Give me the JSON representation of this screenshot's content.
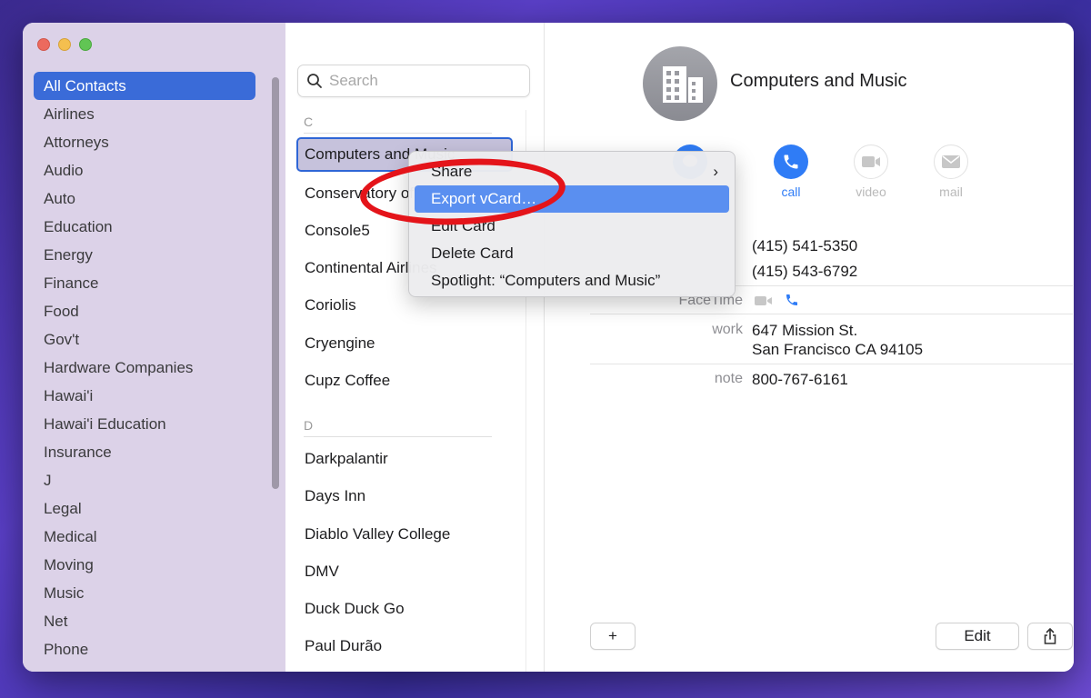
{
  "window": {
    "traffic_lights": [
      "close",
      "minimize",
      "zoom"
    ]
  },
  "sidebar": {
    "groups": [
      {
        "label": "All Contacts",
        "active": true
      },
      {
        "label": "Airlines"
      },
      {
        "label": "Attorneys"
      },
      {
        "label": "Audio"
      },
      {
        "label": "Auto"
      },
      {
        "label": "Education"
      },
      {
        "label": "Energy"
      },
      {
        "label": "Finance"
      },
      {
        "label": "Food"
      },
      {
        "label": "Gov't"
      },
      {
        "label": "Hardware Companies"
      },
      {
        "label": "Hawai'i"
      },
      {
        "label": "Hawai'i Education"
      },
      {
        "label": "Insurance"
      },
      {
        "label": "J"
      },
      {
        "label": "Legal"
      },
      {
        "label": "Medical"
      },
      {
        "label": "Moving"
      },
      {
        "label": "Music"
      },
      {
        "label": "Net"
      },
      {
        "label": "Phone"
      }
    ]
  },
  "list": {
    "search_placeholder": "Search",
    "sections": [
      {
        "header": "C",
        "contacts": [
          "Computers and Music",
          "Conservatory of Music",
          "Console5",
          "Continental Airlines",
          "Coriolis",
          "Cryengine",
          "Cupz Coffee"
        ]
      },
      {
        "header": "D",
        "contacts": [
          "Darkpalantir",
          "Days Inn",
          "Diablo Valley College",
          "DMV",
          "Duck Duck Go",
          "Paul Durão"
        ]
      }
    ],
    "selected": "Computers and Music"
  },
  "detail": {
    "name": "Computers and Music",
    "avatar_icon": "building-icon",
    "actions": [
      {
        "label": "message",
        "enabled": true,
        "icon": "message-icon"
      },
      {
        "label": "call",
        "enabled": true,
        "icon": "phone-icon"
      },
      {
        "label": "video",
        "enabled": false,
        "icon": "video-icon"
      },
      {
        "label": "mail",
        "enabled": false,
        "icon": "mail-icon"
      }
    ],
    "phones": [
      "(415) 541-5350",
      "(415) 543-6792"
    ],
    "facetime_label": "FaceTime",
    "address_label": "work",
    "address_line1": "647 Mission St.",
    "address_line2": "San Francisco CA 94105",
    "note_label": "note",
    "note_value": "800-767-6161",
    "add_button": "+",
    "edit_button": "Edit",
    "share_icon": "share-icon"
  },
  "context_menu": {
    "items": [
      {
        "label": "Share",
        "submenu": true
      },
      {
        "label": "Export vCard…",
        "highlighted": true
      },
      {
        "label": "Edit Card"
      },
      {
        "label": "Delete Card"
      },
      {
        "label": "Spotlight: “Computers and Music”"
      }
    ],
    "chevron": "›"
  },
  "colors": {
    "accent": "#2f7cf6",
    "selection": "#3a6bd8",
    "menu_highlight": "#5a8ff0",
    "annotation": "#e4141a"
  }
}
